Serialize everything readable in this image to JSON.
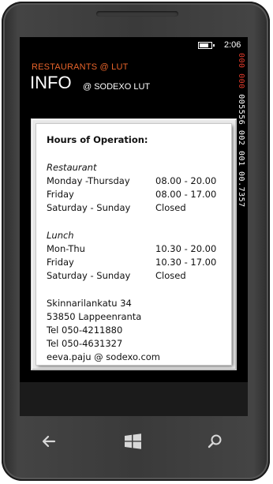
{
  "status": {
    "time": "2:06",
    "battery_icon": "battery-charging-icon"
  },
  "header": {
    "app_name": "RESTAURANTS @ LUT",
    "page_title": "INFO",
    "page_subtitle": "@ SODEXO LUT"
  },
  "debug_counter": {
    "text": "000 000 005556 002 001 00.7357"
  },
  "info": {
    "heading": "Hours of Operation:",
    "restaurant": {
      "title": "Restaurant",
      "rows": [
        {
          "days": "Monday -Thursday",
          "hours": "08.00 - 20.00"
        },
        {
          "days": "Friday",
          "hours": "08.00 - 17.00"
        },
        {
          "days": "Saturday - Sunday",
          "hours": "Closed"
        }
      ]
    },
    "lunch": {
      "title": "Lunch",
      "rows": [
        {
          "days": "Mon-Thu",
          "hours": "10.30 - 20.00"
        },
        {
          "days": "Friday",
          "hours": "10.30 - 17.00"
        },
        {
          "days": "Saturday - Sunday",
          "hours": "Closed"
        }
      ]
    },
    "contact": {
      "street": "Skinnarilankatu 34",
      "city": "53850 Lappeenranta",
      "phone1": "Tel 050-4211880",
      "phone2": "Tel 050-4631327",
      "email": "eeva.paju @ sodexo.com"
    }
  },
  "navbar": {
    "back_icon": "back-arrow-icon",
    "start_icon": "windows-start-icon",
    "search_icon": "search-icon"
  },
  "colors": {
    "accent": "#e8642a",
    "debug_red": "#e03a2a",
    "screen_bg": "#000000"
  }
}
